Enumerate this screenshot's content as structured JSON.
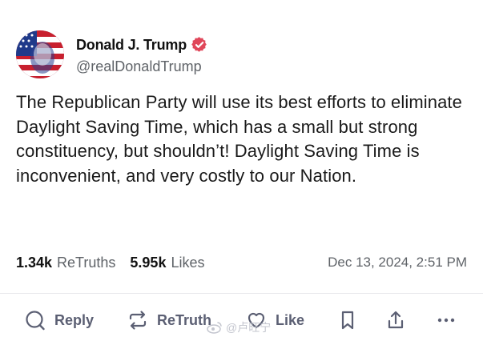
{
  "author": {
    "display_name": "Donald J. Trump",
    "handle": "@realDonaldTrump",
    "verified": true,
    "verified_color": "#e0475a"
  },
  "post": {
    "text": "The Republican Party will use its best efforts to eliminate Daylight Saving Time, which has a small but strong constituency, but shouldn’t! Daylight Saving Time is inconvenient, and very costly to our Nation.",
    "retruths_count": "1.34k",
    "retruths_label": "ReTruths",
    "likes_count": "5.95k",
    "likes_label": "Likes",
    "timestamp": "Dec 13, 2024, 2:51 PM"
  },
  "actions": {
    "reply_label": "Reply",
    "retruth_label": "ReTruth",
    "like_label": "Like",
    "icons": [
      "reply-icon",
      "retruth-icon",
      "like-icon",
      "bookmark-icon",
      "share-icon",
      "more-icon"
    ]
  },
  "watermark": {
    "text": "@卢旺宁"
  },
  "colors": {
    "text": "#1a1a1a",
    "muted": "#5f6368",
    "action": "#5b5f73",
    "divider": "#e8e8ec"
  }
}
